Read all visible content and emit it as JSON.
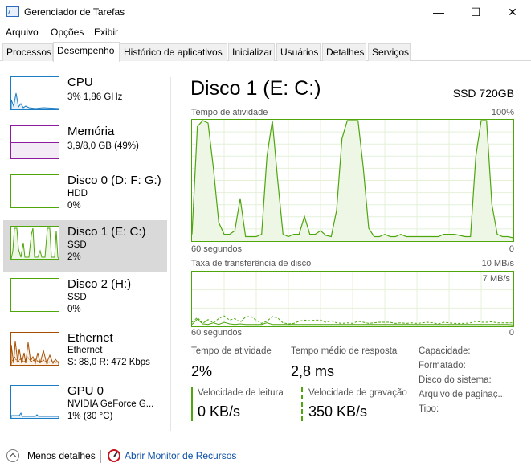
{
  "window": {
    "title": "Gerenciador de Tarefas",
    "controls": {
      "minimize": "—",
      "maximize": "☐",
      "close": "✕"
    }
  },
  "menu": [
    "Arquivo",
    "Opções",
    "Exibir"
  ],
  "tabs": [
    "Processos",
    "Desempenho",
    "Histórico de aplicativos",
    "Inicializar",
    "Usuários",
    "Detalhes",
    "Serviços"
  ],
  "active_tab": "Desempenho",
  "sidebar": {
    "items": [
      {
        "name": "CPU",
        "line1": "3%  1,86 GHz",
        "line2": "",
        "color": "#1a7cc3",
        "fill": "#e7f1fa"
      },
      {
        "name": "Memória",
        "line1": "3,9/8,0 GB (49%)",
        "line2": "",
        "color": "#8b1c9c",
        "fill": "#f3ebf5",
        "level": 0.49
      },
      {
        "name": "Disco 0 (D: F: G:)",
        "line1": "HDD",
        "line2": "0%",
        "color": "#4da60c",
        "fill": "#eef7e6"
      },
      {
        "name": "Disco 1 (E: C:)",
        "line1": "SSD",
        "line2": "2%",
        "color": "#4da60c",
        "fill": "#eef7e6"
      },
      {
        "name": "Disco 2 (H:)",
        "line1": "SSD",
        "line2": "0%",
        "color": "#4da60c",
        "fill": "#eef7e6"
      },
      {
        "name": "Ethernet",
        "line1": "Ethernet",
        "line2": "S: 88,0  R: 472 Kbps",
        "color": "#a74f01",
        "fill": "#fcf3eb"
      },
      {
        "name": "GPU 0",
        "line1": "NVIDIA GeForce G...",
        "line2": "1% (30 °C)",
        "color": "#1a7cc3",
        "fill": "#e7f1fa"
      }
    ],
    "selected": 3
  },
  "main": {
    "title": "Disco 1 (E: C:)",
    "model": "SSD 720GB",
    "graph1": {
      "label": "Tempo de atividade",
      "max": "100%",
      "xleft": "60 segundos",
      "xright": "0"
    },
    "graph2": {
      "label": "Taxa de transferência de disco",
      "max": "10 MB/s",
      "inner_max": "7 MB/s",
      "xleft": "60 segundos",
      "xright": "0"
    }
  },
  "stats": {
    "active_time_label": "Tempo de atividade",
    "active_time": "2%",
    "response_label": "Tempo médio de resposta",
    "response": "2,8 ms",
    "read_label": "Velocidade de leitura",
    "read": "0 KB/s",
    "write_label": "Velocidade de gravação",
    "write": "350 KB/s"
  },
  "properties": [
    "Capacidade:",
    "Formatado:",
    "Disco do sistema:",
    "Arquivo de paginaç...",
    "Tipo:"
  ],
  "footer": {
    "less_details": "Menos detalhes",
    "open_monitor": "Abrir Monitor de Recursos"
  },
  "chart_data": [
    {
      "type": "area",
      "title": "Tempo de atividade",
      "ylim": [
        0,
        100
      ],
      "series": [
        {
          "values": [
            5,
            95,
            100,
            98,
            60,
            15,
            5,
            5,
            8,
            35,
            3,
            3,
            3,
            5,
            70,
            100,
            50,
            5,
            3,
            5,
            5,
            20,
            5,
            5,
            8,
            4,
            3,
            25,
            85,
            100,
            100,
            100,
            60,
            10,
            3,
            3,
            5,
            3,
            3,
            5,
            3,
            3,
            3,
            3,
            3,
            3,
            3,
            5,
            5,
            5,
            4,
            3,
            3,
            70,
            100,
            100,
            30,
            5,
            3,
            3,
            2
          ]
        }
      ]
    },
    {
      "type": "line",
      "title": "Taxa de transferência de disco",
      "ylim": [
        0,
        10
      ],
      "series": [
        {
          "name": "Velocidade de leitura",
          "values": [
            0.2,
            1.2,
            0.3,
            0.2,
            0.5,
            0.2,
            0.6,
            0.3,
            0.2,
            0.3,
            0.2,
            0.2,
            0.2,
            0.2,
            0.5,
            0.2,
            0.2,
            0.2,
            0.2,
            0.2,
            0.2,
            0.2,
            0.2,
            0.2,
            0.2,
            0.2,
            0.2,
            0.2,
            0.2,
            0.2,
            0.2,
            0.2,
            0.2,
            0.2,
            0.2,
            0.2,
            0.2,
            0.2,
            0.2,
            0.2,
            0.2,
            0.2,
            0.2,
            0.2,
            0.2,
            0.2,
            0.2,
            0.2,
            0.2,
            0.2,
            0.2,
            0.2,
            0.2,
            0.2,
            0.2,
            0.2,
            0.2,
            0.2,
            0.2,
            0.2,
            0.1
          ]
        },
        {
          "name": "Velocidade de gravação",
          "values": [
            0.6,
            1.5,
            0.4,
            1.1,
            0.5,
            1.3,
            1.8,
            1.0,
            1.3,
            0.6,
            1.6,
            1.7,
            1.0,
            0.4,
            0.8,
            1.7,
            1.4,
            0.5,
            0.3,
            0.4,
            0.8,
            1.0,
            0.9,
            1.0,
            1.0,
            0.6,
            0.9,
            0.5,
            0.4,
            0.5,
            0.4,
            0.8,
            0.6,
            0.4,
            0.5,
            0.6,
            0.6,
            0.6,
            0.4,
            0.5,
            0.4,
            0.5,
            0.4,
            0.5,
            0.6,
            0.5,
            0.3,
            0.6,
            0.5,
            0.4,
            0.4,
            0.4,
            0.5,
            0.8,
            0.6,
            0.6,
            0.7,
            0.5,
            0.5,
            0.5,
            0.5
          ]
        }
      ]
    }
  ]
}
